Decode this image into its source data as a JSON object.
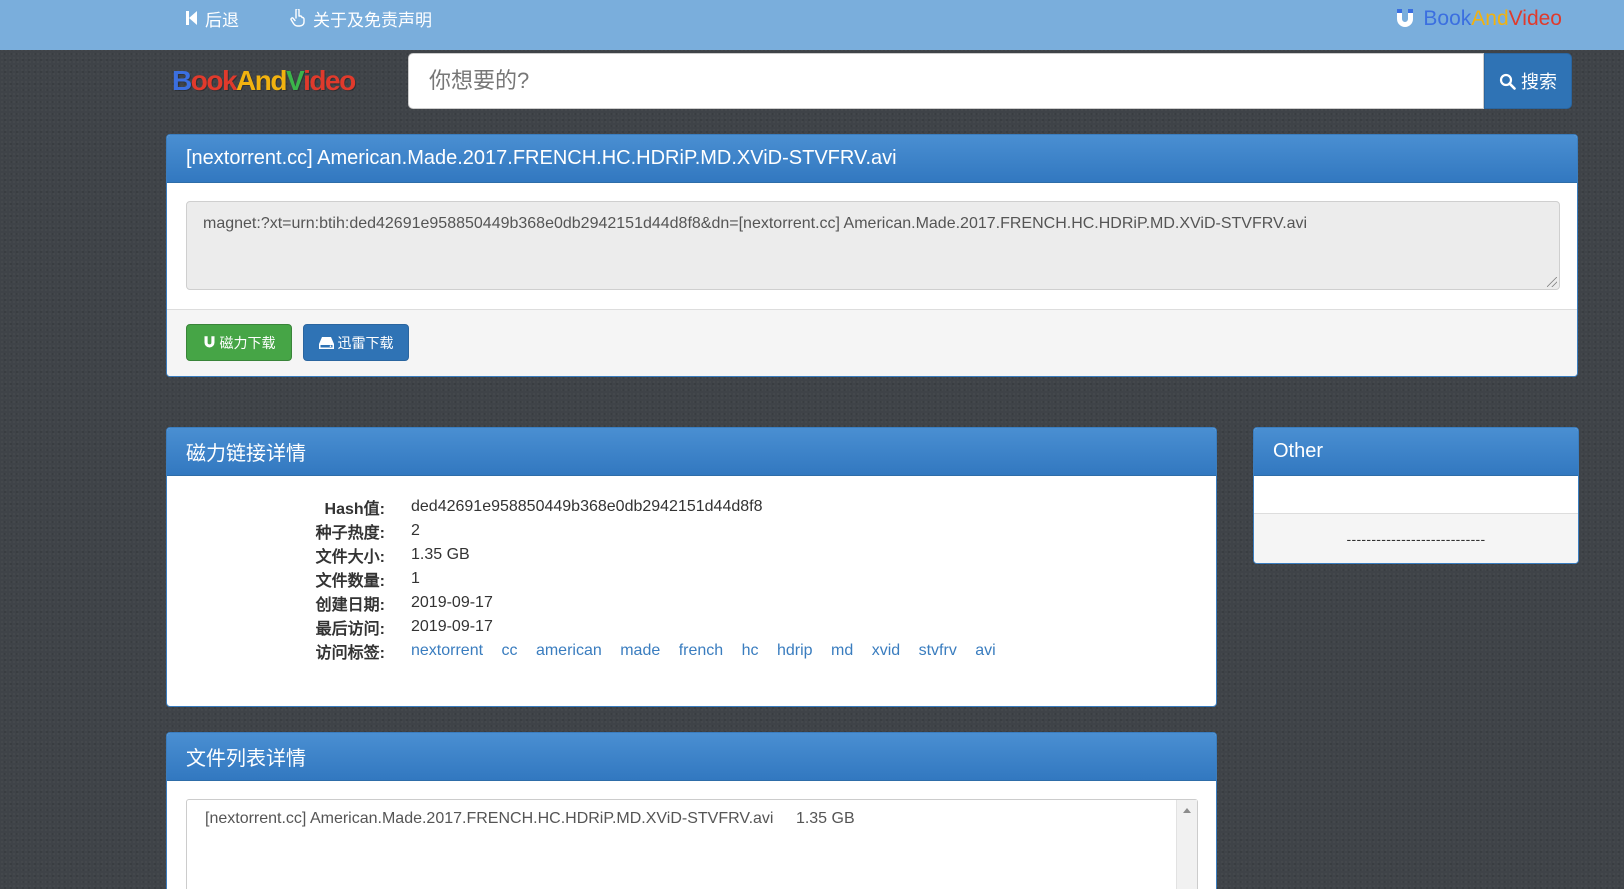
{
  "nav": {
    "back_label": "后退",
    "about_label": "关于及免责声明",
    "brand": {
      "book": "Book",
      "and": "And",
      "video": "Video"
    }
  },
  "logo": {
    "b": "B",
    "ook": "ook",
    "and": "And",
    "v": "V",
    "ideo": "ideo"
  },
  "search": {
    "placeholder": "你想要的?",
    "button_label": "搜索"
  },
  "torrent": {
    "title": "[nextorrent.cc] American.Made.2017.FRENCH.HC.HDRiP.MD.XViD-STVFRV.avi",
    "magnet": "magnet:?xt=urn:btih:ded42691e958850449b368e0db2942151d44d8f8&dn=[nextorrent.cc] American.Made.2017.FRENCH.HC.HDRiP.MD.XViD-STVFRV.avi",
    "magnet_button": "磁力下载",
    "thunder_button": "迅雷下载"
  },
  "details": {
    "heading": "磁力链接详情",
    "rows": [
      {
        "label": "Hash值:",
        "value": "ded42691e958850449b368e0db2942151d44d8f8"
      },
      {
        "label": "种子热度:",
        "value": "2"
      },
      {
        "label": "文件大小:",
        "value": "1.35 GB"
      },
      {
        "label": "文件数量:",
        "value": "1"
      },
      {
        "label": "创建日期:",
        "value": "2019-09-17"
      },
      {
        "label": "最后访问:",
        "value": "2019-09-17"
      }
    ],
    "tags_label": "访问标签:",
    "tags": [
      "nextorrent",
      "cc",
      "american",
      "made",
      "french",
      "hc",
      "hdrip",
      "md",
      "xvid",
      "stvfrv",
      "avi"
    ]
  },
  "files": {
    "heading": "文件列表详情",
    "items": [
      {
        "name": "[nextorrent.cc] American.Made.2017.FRENCH.HC.HDRiP.MD.XViD-STVFRV.avi",
        "size": "1.35 GB"
      }
    ]
  },
  "other": {
    "heading": "Other",
    "footer": "----------------------------"
  },
  "colors": {
    "navbar": "#7aaedc",
    "panel_heading": "#3a7dbf",
    "magnet_button": "#46a546",
    "thunder_button": "#2f73b5",
    "link": "#3a7dbf"
  },
  "icons": {
    "back": "step-backward-icon",
    "about": "hand-pointer-icon",
    "brand": "magnet-icon",
    "search": "search-icon",
    "magnet_button": "magnet-icon",
    "thunder_button": "hard-drive-icon"
  }
}
